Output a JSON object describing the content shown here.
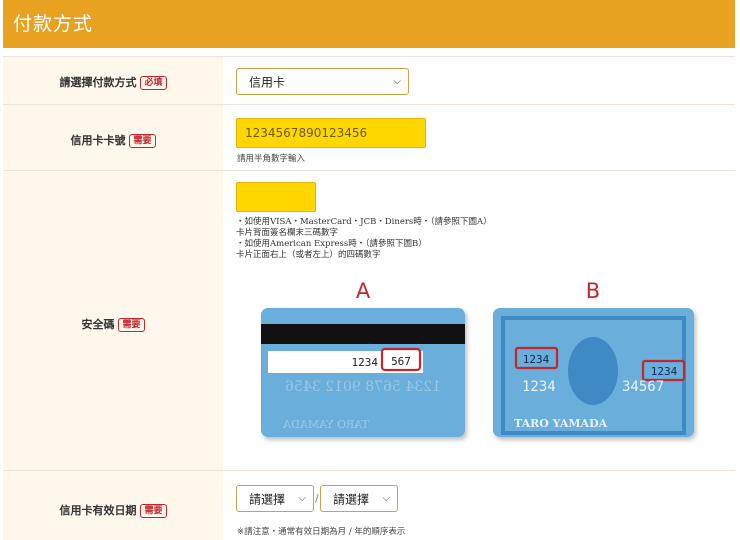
{
  "header": {
    "title": "付款方式"
  },
  "payment_method": {
    "label": "請選擇付款方式",
    "badge": "必填",
    "selected": "信用卡"
  },
  "card_number": {
    "label": "信用卡卡號",
    "badge": "需要",
    "value": "1234567890123456",
    "hint": "請用半角數字輸入"
  },
  "security_code": {
    "label": "安全碼",
    "badge": "需要",
    "value": "",
    "instructions": [
      "・如使用VISA・MasterCard・JCB・Diners時・（請參照下圖A）",
      "卡片背面簽名欄末三碼數字",
      "・如使用American Express時・（請參照下圖B）",
      "卡片正面右上（或者左上）的四碼數字"
    ],
    "card_a": {
      "letter": "A",
      "number_prefix": "1234",
      "cvv": "567",
      "mirrored_number": "1234 5678 9012 3456",
      "mirrored_name": "TARO YAMADA"
    },
    "card_b": {
      "letter": "B",
      "code_left": "1234",
      "code_right": "1234",
      "number_left": "1234",
      "number_right": "34567",
      "name": "TARO YAMADA"
    }
  },
  "expiry": {
    "label": "信用卡有效日期",
    "badge": "需要",
    "month_placeholder": "請選擇",
    "separator": "/",
    "year_placeholder": "請選擇",
    "note": "※請注意・通常有效日期為月 / 年的順序表示"
  },
  "colors": {
    "header": "#E9A122",
    "label_bg": "#FEF7EB",
    "input_yellow": "#FFD700",
    "badge_red": "#C1272D",
    "card_blue": "#6AAEDB",
    "card_dark_blue": "#3F89C4"
  }
}
